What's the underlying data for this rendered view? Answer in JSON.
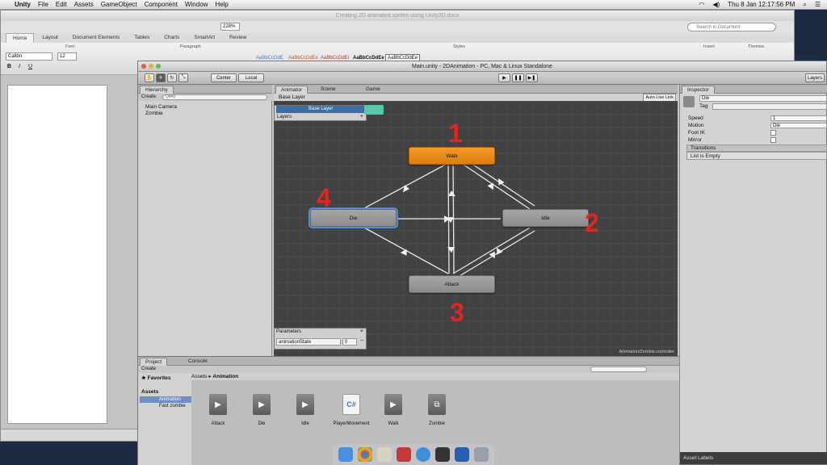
{
  "menubar": {
    "app": "Unity",
    "items": [
      "File",
      "Edit",
      "Assets",
      "GameObject",
      "Component",
      "Window",
      "Help"
    ],
    "clock": "Thu 8 Jan  12:17:56 PM"
  },
  "word": {
    "title": "Creating 2D animated sprites using Unity2D.docx",
    "tabs": [
      "Home",
      "Layout",
      "Document Elements",
      "Tables",
      "Charts",
      "SmartArt",
      "Review"
    ],
    "font_name": "Calibri",
    "font_size": "12",
    "zoom": "228%",
    "search_placeholder": "Search in Document",
    "groups": [
      "Font",
      "Paragraph",
      "Styles",
      "Insert",
      "Themes"
    ],
    "style_samples": [
      "AaBbCcDdE",
      "AaBbCcDdEe",
      "AaBbCcDdEr",
      "AaBbCcDdEe",
      "AaBbCcDdEe"
    ],
    "bookmarks": "Bookmarks"
  },
  "unity": {
    "title": "Main.unity - 2DAnimation - PC, Mac & Linux Standalone",
    "center_btn": "Center",
    "local_btn": "Local",
    "layers_btn": "Layers",
    "hierarchy": {
      "tab": "Hierarchy",
      "create": "Create",
      "search_placeholder": "Q▾All",
      "items": [
        "Main Camera",
        "Zombie"
      ]
    },
    "animator": {
      "tabs": [
        "Animator",
        "Scene",
        "Game"
      ],
      "base_layer": "Base Layer",
      "auto_live_link": "Auto Live Link",
      "layers_label": "Layers",
      "controller_path": "Animation/Zombie.controller",
      "states": {
        "walk": "Walk",
        "idle": "Idle",
        "attack": "Attack",
        "die": "Die"
      },
      "numbers": [
        "1",
        "2",
        "3",
        "4"
      ],
      "parameters": {
        "label": "Parameters",
        "name": "animationState",
        "value": "0"
      }
    },
    "inspector": {
      "tab": "Inspector",
      "object_name": "Die",
      "tag_label": "Tag",
      "speed_label": "Speed",
      "speed_value": "1",
      "motion_label": "Motion",
      "motion_value": "Die",
      "foot_ik_label": "Foot IK",
      "mirror_label": "Mirror",
      "transitions_label": "Transitions",
      "transitions_value": "List is Empty",
      "asset_labels": "Asset Labels"
    },
    "project": {
      "tabs": [
        "Project",
        "Console"
      ],
      "create": "Create",
      "favorites": "Favorites",
      "assets": "Assets",
      "folders": [
        "Animation",
        "Fast zombie"
      ],
      "breadcrumb_root": "Assets",
      "breadcrumb_sep": "▸",
      "breadcrumb_leaf": "Animation",
      "items": [
        "Attack",
        "Die",
        "Idle",
        "PlayerMovement",
        "Walk",
        "Zombie"
      ]
    }
  },
  "colors": {
    "default_state": "#f08f1a",
    "number_red": "#e3241f",
    "selection_blue": "#4a8fd8"
  }
}
